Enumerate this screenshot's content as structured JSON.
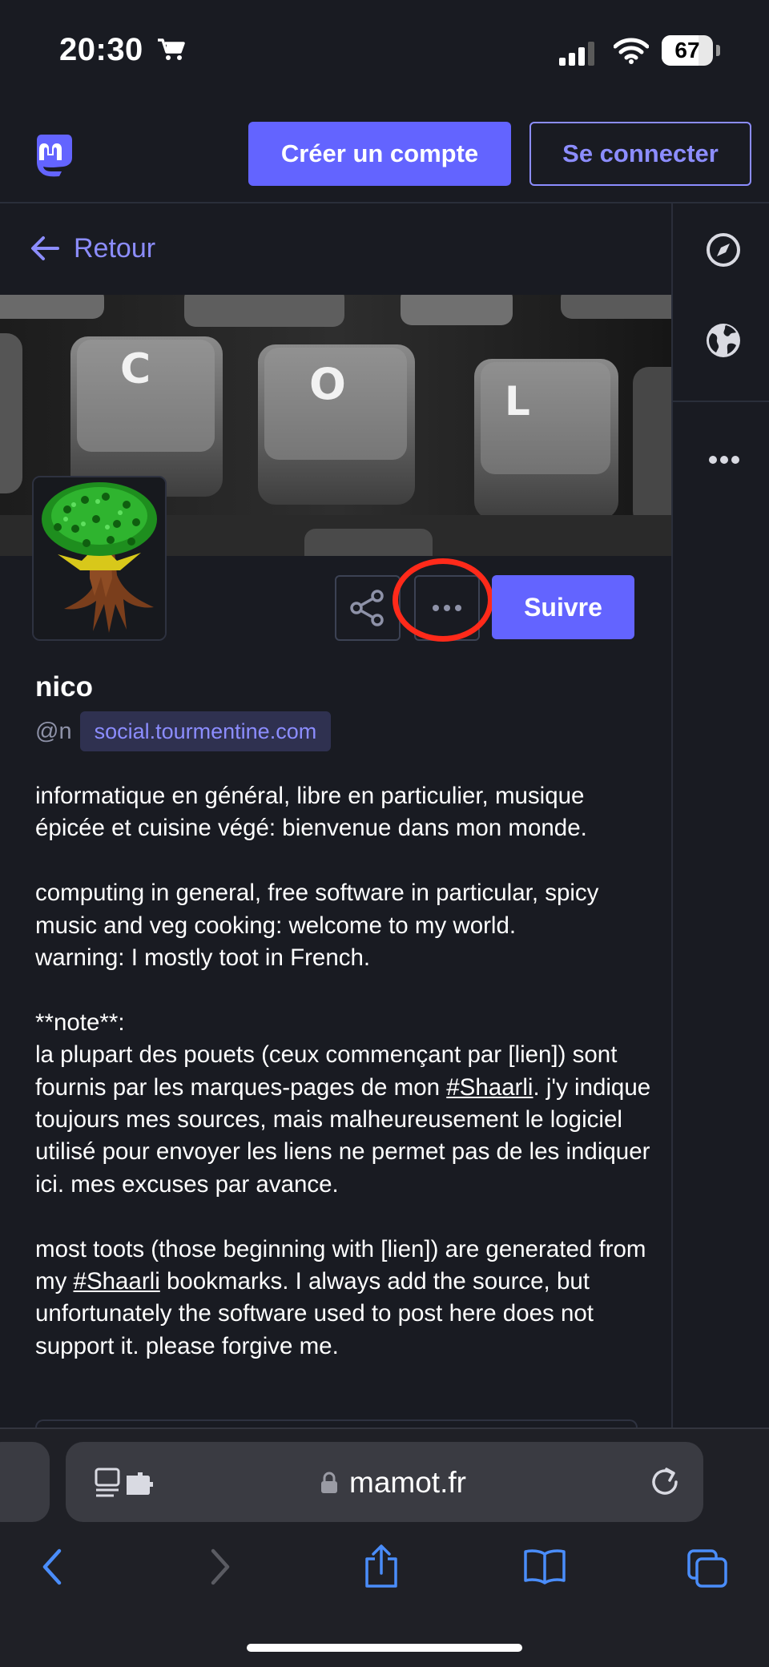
{
  "status": {
    "time": "20:30",
    "battery": "67"
  },
  "header": {
    "create_account": "Créer un compte",
    "login": "Se connecter"
  },
  "nav": {
    "back_label": "Retour"
  },
  "profile": {
    "display_name": "nico",
    "handle_prefix": "@n",
    "domain": "social.tourmentine.com",
    "follow_label": "Suivre",
    "bio": {
      "p1": "informatique en général, libre en particulier, musique épicée et cuisine végé: bienvenue dans mon monde.",
      "p2_l1": "computing in general, free software in particular, spicy music and veg cooking: welcome to my world.",
      "p2_l2": "warning: I mostly toot in French.",
      "p3_l1": "**note**:",
      "p3_l2_a": "la plupart des pouets (ceux commençant par [lien]) sont fournis par les marques-pages de mon ",
      "hashtag1": "#Shaarli",
      "p3_l2_b": ". j'y indique toujours mes sources, mais malheureusement le logiciel utilisé pour envoyer les liens ne permet pas de les indiquer ici. mes excuses par avance.",
      "p4_a": "most toots (those beginning with [lien]) are generated from my ",
      "hashtag2": "#Shaarli",
      "p4_b": " bookmarks. I always add the source, but unfortunately the software used to post here does not support it. please forgive me."
    },
    "banner_keys": [
      "C",
      "O",
      "L"
    ]
  },
  "browser": {
    "url": "mamot.fr"
  },
  "colors": {
    "accent": "#6364ff",
    "background": "#191b22",
    "highlight": "#ff2a1a"
  }
}
